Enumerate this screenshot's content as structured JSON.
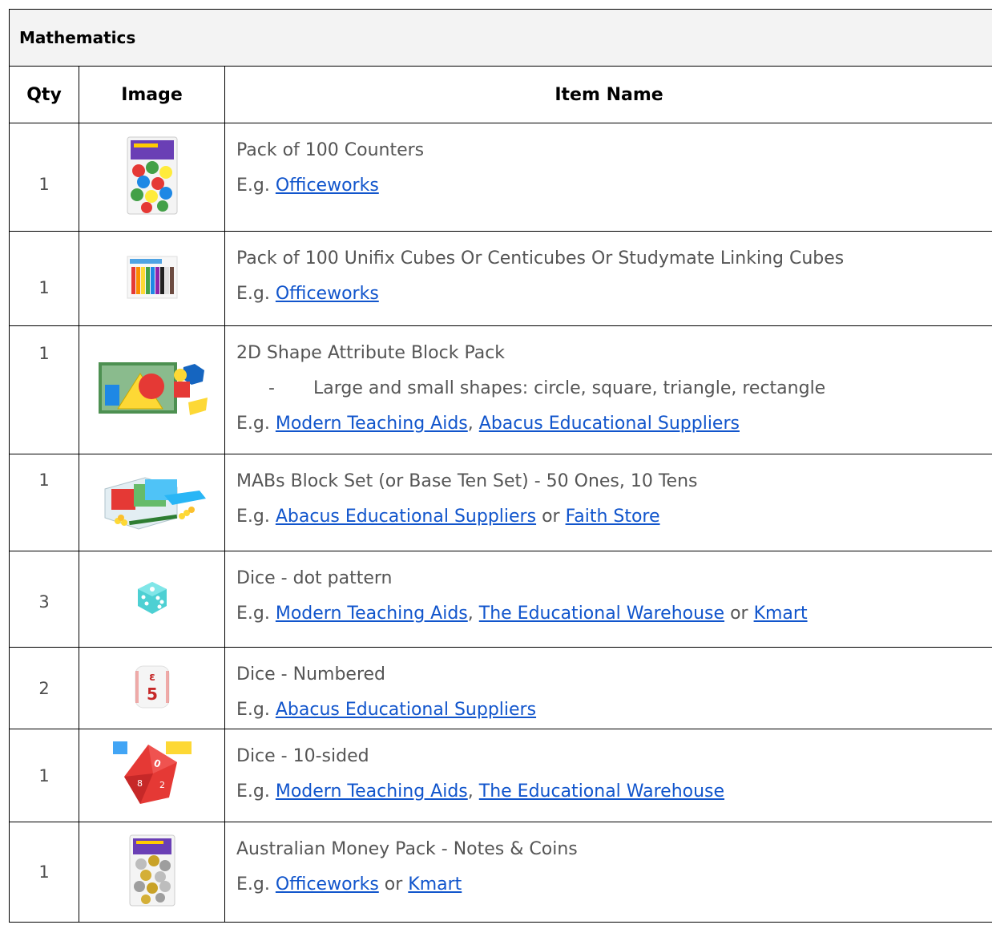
{
  "table": {
    "title": "Mathematics",
    "headers": {
      "qty": "Qty",
      "image": "Image",
      "item": "Item Name"
    },
    "rows": [
      {
        "qty": "1",
        "image_icon": "counters-pack-icon",
        "name": "Pack of 100 Counters",
        "eg": "E.g.",
        "links": [
          "Officeworks"
        ]
      },
      {
        "qty": "1",
        "image_icon": "unifix-cubes-icon",
        "name": "Pack of 100 Unifix Cubes Or Centicubes Or Studymate Linking Cubes",
        "eg": "E.g.",
        "links": [
          "Officeworks"
        ]
      },
      {
        "qty": "1",
        "image_icon": "attribute-blocks-icon",
        "name": "2D Shape Attribute Block Pack",
        "sub_dash": "-",
        "sub": "Large and small shapes: circle, square, triangle, rectangle",
        "eg": "E.g.",
        "links": [
          "Modern Teaching Aids",
          "Abacus Educational Suppliers"
        ],
        "sep": ","
      },
      {
        "qty": "1",
        "image_icon": "mab-blocks-icon",
        "name": "MABs Block Set (or Base Ten Set) - 50 Ones, 10 Tens",
        "eg": "E.g.",
        "links": [
          "Abacus Educational Suppliers",
          "Faith Store"
        ],
        "sep": "or"
      },
      {
        "qty": "3",
        "image_icon": "dot-dice-icon",
        "name": "Dice - dot pattern",
        "eg": "E.g.",
        "links": [
          "Modern Teaching Aids",
          "The Educational Warehouse",
          "Kmart"
        ],
        "sep": ",",
        "sep2": "or"
      },
      {
        "qty": "2",
        "image_icon": "numbered-dice-icon",
        "name": "Dice - Numbered",
        "eg": "E.g.",
        "links": [
          "Abacus Educational Suppliers"
        ],
        "die_digits": [
          "ε",
          "5"
        ]
      },
      {
        "qty": "1",
        "image_icon": "ten-sided-dice-icon",
        "name": "Dice - 10-sided",
        "eg": "E.g.",
        "links": [
          "Modern Teaching Aids",
          "The Educational Warehouse"
        ],
        "sep": ","
      },
      {
        "qty": "1",
        "image_icon": "money-pack-icon",
        "name": "Australian Money Pack - Notes & Coins",
        "eg": "E.g.",
        "links": [
          "Officeworks",
          "Kmart"
        ],
        "sep": "or"
      }
    ]
  }
}
